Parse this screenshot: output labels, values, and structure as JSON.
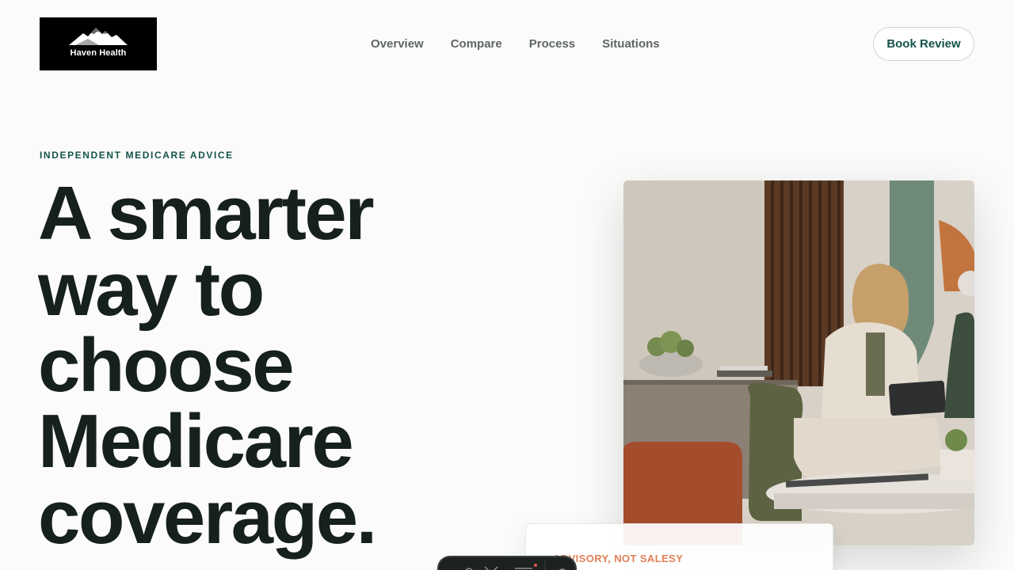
{
  "brand": {
    "name": "Haven Health",
    "logo_icon": "mountain-logo-icon"
  },
  "nav": {
    "items": [
      {
        "label": "Overview"
      },
      {
        "label": "Compare"
      },
      {
        "label": "Process"
      },
      {
        "label": "Situations"
      }
    ]
  },
  "header": {
    "cta_label": "Book Review"
  },
  "hero": {
    "eyebrow": "INDEPENDENT MEDICARE ADVICE",
    "headline": "A smarter way to choose Medicare coverage."
  },
  "card": {
    "label": "ADVISORY, NOT SALESY"
  },
  "colors": {
    "accent": "#14524a",
    "highlight": "#e07f55",
    "text": "#16201d"
  }
}
